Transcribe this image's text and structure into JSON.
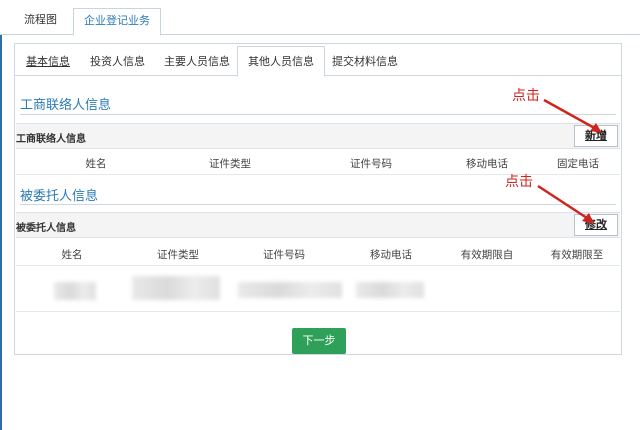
{
  "outer_tabs": [
    "流程图",
    "企业登记业务"
  ],
  "inner_tabs": [
    "基本信息",
    "投资人信息",
    "主要人员信息",
    "其他人员信息",
    "提交材料信息"
  ],
  "section1": {
    "title": "工商联络人信息",
    "bar_label": "工商联络人信息",
    "button": "新增",
    "columns": [
      "姓名",
      "证件类型",
      "证件号码",
      "移动电话",
      "固定电话"
    ]
  },
  "section2": {
    "title": "被委托人信息",
    "bar_label": "被委托人信息",
    "button": "修改",
    "columns": [
      "姓名",
      "证件类型",
      "证件号码",
      "移动电话",
      "有效期限自",
      "有效期限至"
    ]
  },
  "next_button": "下一步",
  "callouts": [
    "点击",
    "点击"
  ],
  "colors": {
    "accent": "#2a7bb8",
    "callout": "#d0251f",
    "next": "#2ea05a"
  }
}
